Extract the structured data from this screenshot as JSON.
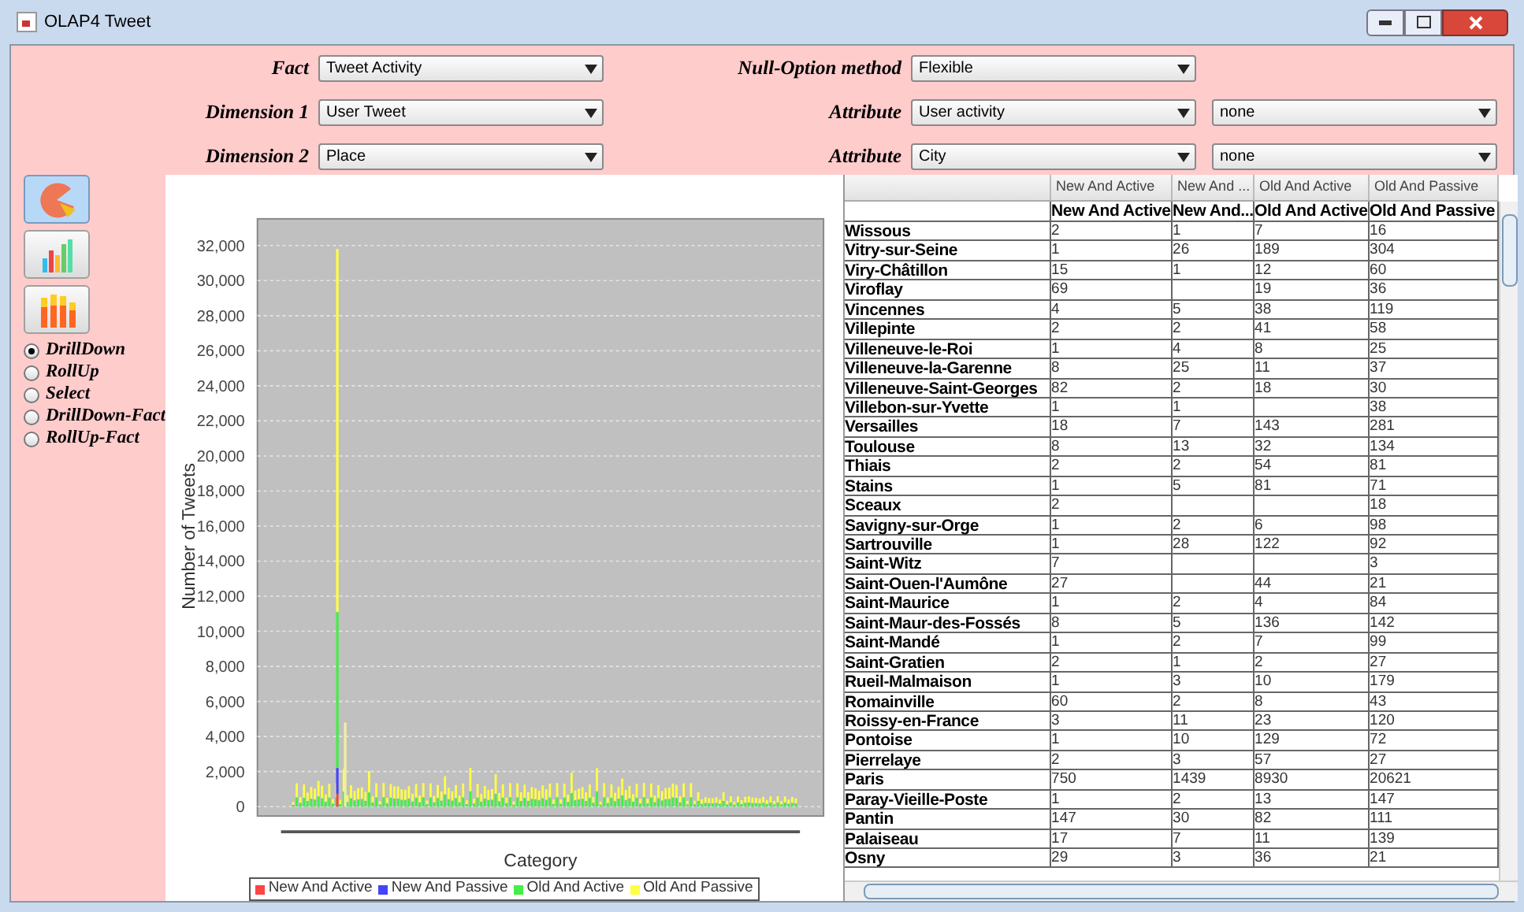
{
  "window": {
    "title": "OLAP4 Tweet"
  },
  "form": {
    "rows": [
      {
        "label": "Fact",
        "value": "Tweet Activity",
        "right_label": "Null-Option method",
        "right_values": [
          "Flexible"
        ]
      },
      {
        "label": "Dimension 1",
        "value": "User Tweet",
        "right_label": "Attribute",
        "right_values": [
          "User activity",
          "none"
        ]
      },
      {
        "label": "Dimension 2",
        "value": "Place",
        "right_label": "Attribute",
        "right_values": [
          "City",
          "none"
        ]
      }
    ]
  },
  "chart_buttons": [
    {
      "kind": "pie",
      "selected": true
    },
    {
      "kind": "bar",
      "selected": false
    },
    {
      "kind": "stacked",
      "selected": false
    }
  ],
  "operations": [
    {
      "label": "DrillDown",
      "selected": true
    },
    {
      "label": "RollUp",
      "selected": false
    },
    {
      "label": "Select",
      "selected": false
    },
    {
      "label": "DrillDown-Fact",
      "selected": false
    },
    {
      "label": "RollUp-Fact",
      "selected": false
    }
  ],
  "chart": {
    "ylabel": "Number of Tweets",
    "xlabel": "Category",
    "yticks": [
      "32,000",
      "30,000",
      "28,000",
      "26,000",
      "24,000",
      "22,000",
      "20,000",
      "18,000",
      "16,000",
      "14,000",
      "12,000",
      "10,000",
      "8,000",
      "6,000",
      "4,000",
      "2,000",
      "0"
    ],
    "legend": [
      {
        "label": "New And Active",
        "color": "#ff4444"
      },
      {
        "label": "New And Passive",
        "color": "#4444ff"
      },
      {
        "label": "Old And Active",
        "color": "#44ee44"
      },
      {
        "label": "Old And Passive",
        "color": "#ffff44"
      }
    ]
  },
  "table": {
    "group_headers": [
      "New And Active",
      "New And ...",
      "Old And Active",
      "Old And Passive"
    ],
    "columns": [
      "New And Active",
      "New And...",
      "Old And Active",
      "Old And Passive"
    ],
    "rows": [
      {
        "place": "Wissous",
        "new_active": "2",
        "new_passive": "1",
        "old_active": "7",
        "old_passive": "16"
      },
      {
        "place": "Vitry-sur-Seine",
        "new_active": "1",
        "new_passive": "26",
        "old_active": "189",
        "old_passive": "304"
      },
      {
        "place": "Viry-Châtillon",
        "new_active": "15",
        "new_passive": "1",
        "old_active": "12",
        "old_passive": "60"
      },
      {
        "place": "Viroflay",
        "new_active": "69",
        "old_active": "19",
        "old_passive": "36"
      },
      {
        "place": "Vincennes",
        "new_active": "4",
        "new_passive": "5",
        "old_active": "38",
        "old_passive": "119"
      },
      {
        "place": "Villepinte",
        "new_active": "2",
        "new_passive": "2",
        "old_active": "41",
        "old_passive": "58"
      },
      {
        "place": "Villeneuve-le-Roi",
        "new_active": "1",
        "new_passive": "4",
        "old_active": "8",
        "old_passive": "25"
      },
      {
        "place": "Villeneuve-la-Garenne",
        "new_active": "8",
        "new_passive": "25",
        "old_active": "11",
        "old_passive": "37"
      },
      {
        "place": "Villeneuve-Saint-Georges",
        "new_active": "82",
        "new_passive": "2",
        "old_active": "18",
        "old_passive": "30"
      },
      {
        "place": "Villebon-sur-Yvette",
        "new_active": "1",
        "new_passive": "1",
        "old_passive": "38"
      },
      {
        "place": "Versailles",
        "new_active": "18",
        "new_passive": "7",
        "old_active": "143",
        "old_passive": "281"
      },
      {
        "place": "Toulouse",
        "new_active": "8",
        "new_passive": "13",
        "old_active": "32",
        "old_passive": "134"
      },
      {
        "place": "Thiais",
        "new_active": "2",
        "new_passive": "2",
        "old_active": "54",
        "old_passive": "81"
      },
      {
        "place": "Stains",
        "new_active": "1",
        "new_passive": "5",
        "old_active": "81",
        "old_passive": "71"
      },
      {
        "place": "Sceaux",
        "new_active": "2",
        "old_passive": "18"
      },
      {
        "place": "Savigny-sur-Orge",
        "new_active": "1",
        "new_passive": "2",
        "old_active": "6",
        "old_passive": "98"
      },
      {
        "place": "Sartrouville",
        "new_active": "1",
        "new_passive": "28",
        "old_active": "122",
        "old_passive": "92"
      },
      {
        "place": "Saint-Witz",
        "new_active": "7",
        "old_passive": "3"
      },
      {
        "place": "Saint-Ouen-l'Aumône",
        "new_active": "27",
        "old_active": "44",
        "old_passive": "21"
      },
      {
        "place": "Saint-Maurice",
        "new_active": "1",
        "new_passive": "2",
        "old_active": "4",
        "old_passive": "84"
      },
      {
        "place": "Saint-Maur-des-Fossés",
        "new_active": "8",
        "new_passive": "5",
        "old_active": "136",
        "old_passive": "142"
      },
      {
        "place": "Saint-Mandé",
        "new_active": "1",
        "new_passive": "2",
        "old_active": "7",
        "old_passive": "99"
      },
      {
        "place": "Saint-Gratien",
        "new_active": "2",
        "new_passive": "1",
        "old_active": "2",
        "old_passive": "27"
      },
      {
        "place": "Rueil-Malmaison",
        "new_active": "1",
        "new_passive": "3",
        "old_active": "10",
        "old_passive": "179"
      },
      {
        "place": "Romainville",
        "new_active": "60",
        "new_passive": "2",
        "old_active": "8",
        "old_passive": "43"
      },
      {
        "place": "Roissy-en-France",
        "new_active": "3",
        "new_passive": "11",
        "old_active": "23",
        "old_passive": "120"
      },
      {
        "place": "Pontoise",
        "new_active": "1",
        "new_passive": "10",
        "old_active": "129",
        "old_passive": "72"
      },
      {
        "place": "Pierrelaye",
        "new_active": "2",
        "new_passive": "3",
        "old_active": "57",
        "old_passive": "27"
      },
      {
        "place": "Paris",
        "new_active": "750",
        "new_passive": "1439",
        "old_active": "8930",
        "old_passive": "20621"
      },
      {
        "place": "Paray-Vieille-Poste",
        "new_active": "1",
        "new_passive": "2",
        "old_active": "13",
        "old_passive": "147"
      },
      {
        "place": "Pantin",
        "new_active": "147",
        "new_passive": "30",
        "old_active": "82",
        "old_passive": "111"
      },
      {
        "place": "Palaiseau",
        "new_active": "17",
        "new_passive": "7",
        "old_active": "11",
        "old_passive": "139"
      },
      {
        "place": "Osny",
        "new_active": "29",
        "new_passive": "3",
        "old_active": "36",
        "old_passive": "21"
      }
    ]
  }
}
